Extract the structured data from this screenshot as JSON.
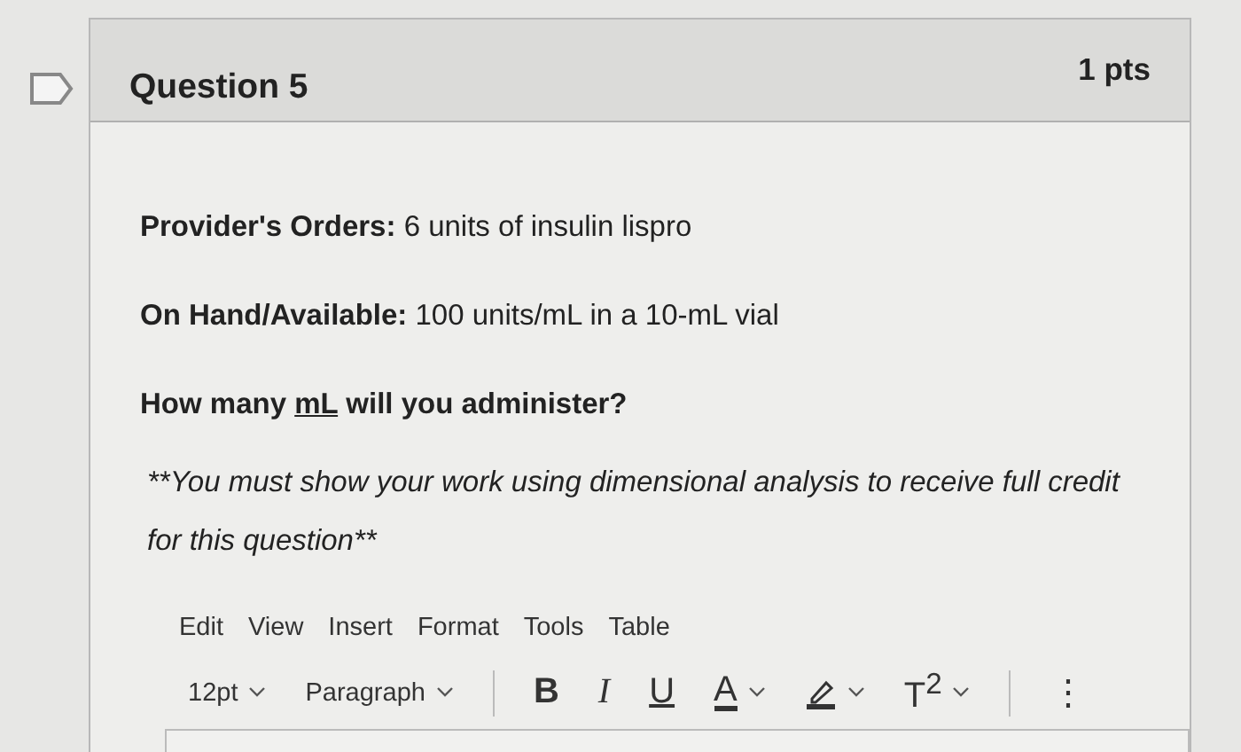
{
  "question": {
    "title": "Question 5",
    "points": "1 pts"
  },
  "lines": [
    {
      "kind": "rich",
      "text": "**Provider's Orders:** 6 units of insulin lispro"
    },
    {
      "kind": "rich",
      "text": "**On Hand/Available:** 100 units/mL in a 10-mL vial"
    },
    {
      "kind": "underline",
      "before": "How many ",
      "underlined": "mL",
      "after": " will you administer?"
    },
    {
      "kind": "italic",
      "text": "**You must show your work using dimensional analysis to receive full credit for this question**"
    }
  ],
  "menu": [
    "Edit",
    "View",
    "Insert",
    "Format",
    "Tools",
    "Table"
  ],
  "toolbar": [
    {
      "kind": "dropdown",
      "text": "12pt"
    },
    {
      "kind": "dropdown",
      "text": "Paragraph"
    },
    {
      "kind": "sep"
    },
    {
      "kind": "bold",
      "text": "B"
    },
    {
      "kind": "italic",
      "text": "I"
    },
    {
      "kind": "underline",
      "text": "U"
    },
    {
      "kind": "color",
      "text": "A"
    },
    {
      "kind": "highlight"
    },
    {
      "kind": "super",
      "text": "T$^{2}$"
    },
    {
      "kind": "sep"
    },
    {
      "kind": "more",
      "text": "⋮"
    }
  ]
}
